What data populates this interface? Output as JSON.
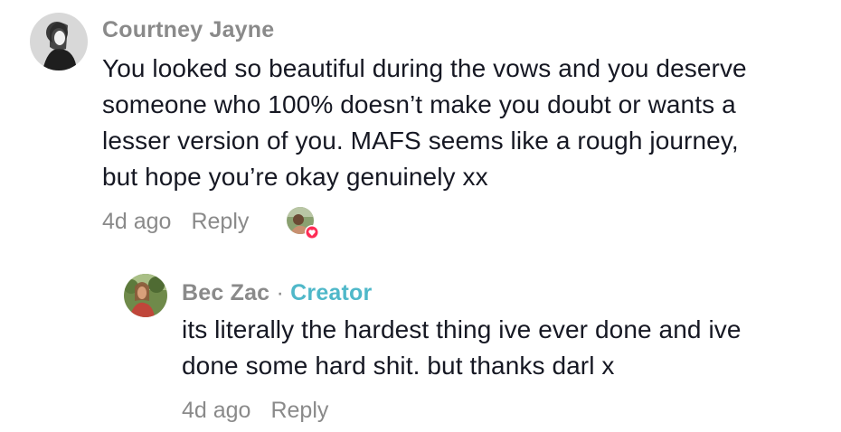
{
  "comments": [
    {
      "username": "Courtney Jayne",
      "text_lines": [
        "You looked so beautiful during the vows and you deserve",
        "someone who 100% doesn’t make you doubt or wants a",
        "lesser version of you. MAFS seems like a rough journey,",
        "but hope you’re okay genuinely xx"
      ],
      "timestamp": "4d ago",
      "reply_label": "Reply",
      "liked_by_creator_icon": "creator-liked-heart-icon"
    }
  ],
  "replies": [
    {
      "username": "Bec Zac",
      "separator": "·",
      "badge": "Creator",
      "text_lines": [
        "its literally the hardest thing ive ever done and ive",
        "done some hard shit. but thanks darl x"
      ],
      "timestamp": "4d ago",
      "reply_label": "Reply"
    }
  ],
  "colors": {
    "username": "#8a8a8a",
    "body_text": "#161823",
    "creator_badge": "#4fb8c9",
    "heart_badge": "#fe2c55"
  }
}
